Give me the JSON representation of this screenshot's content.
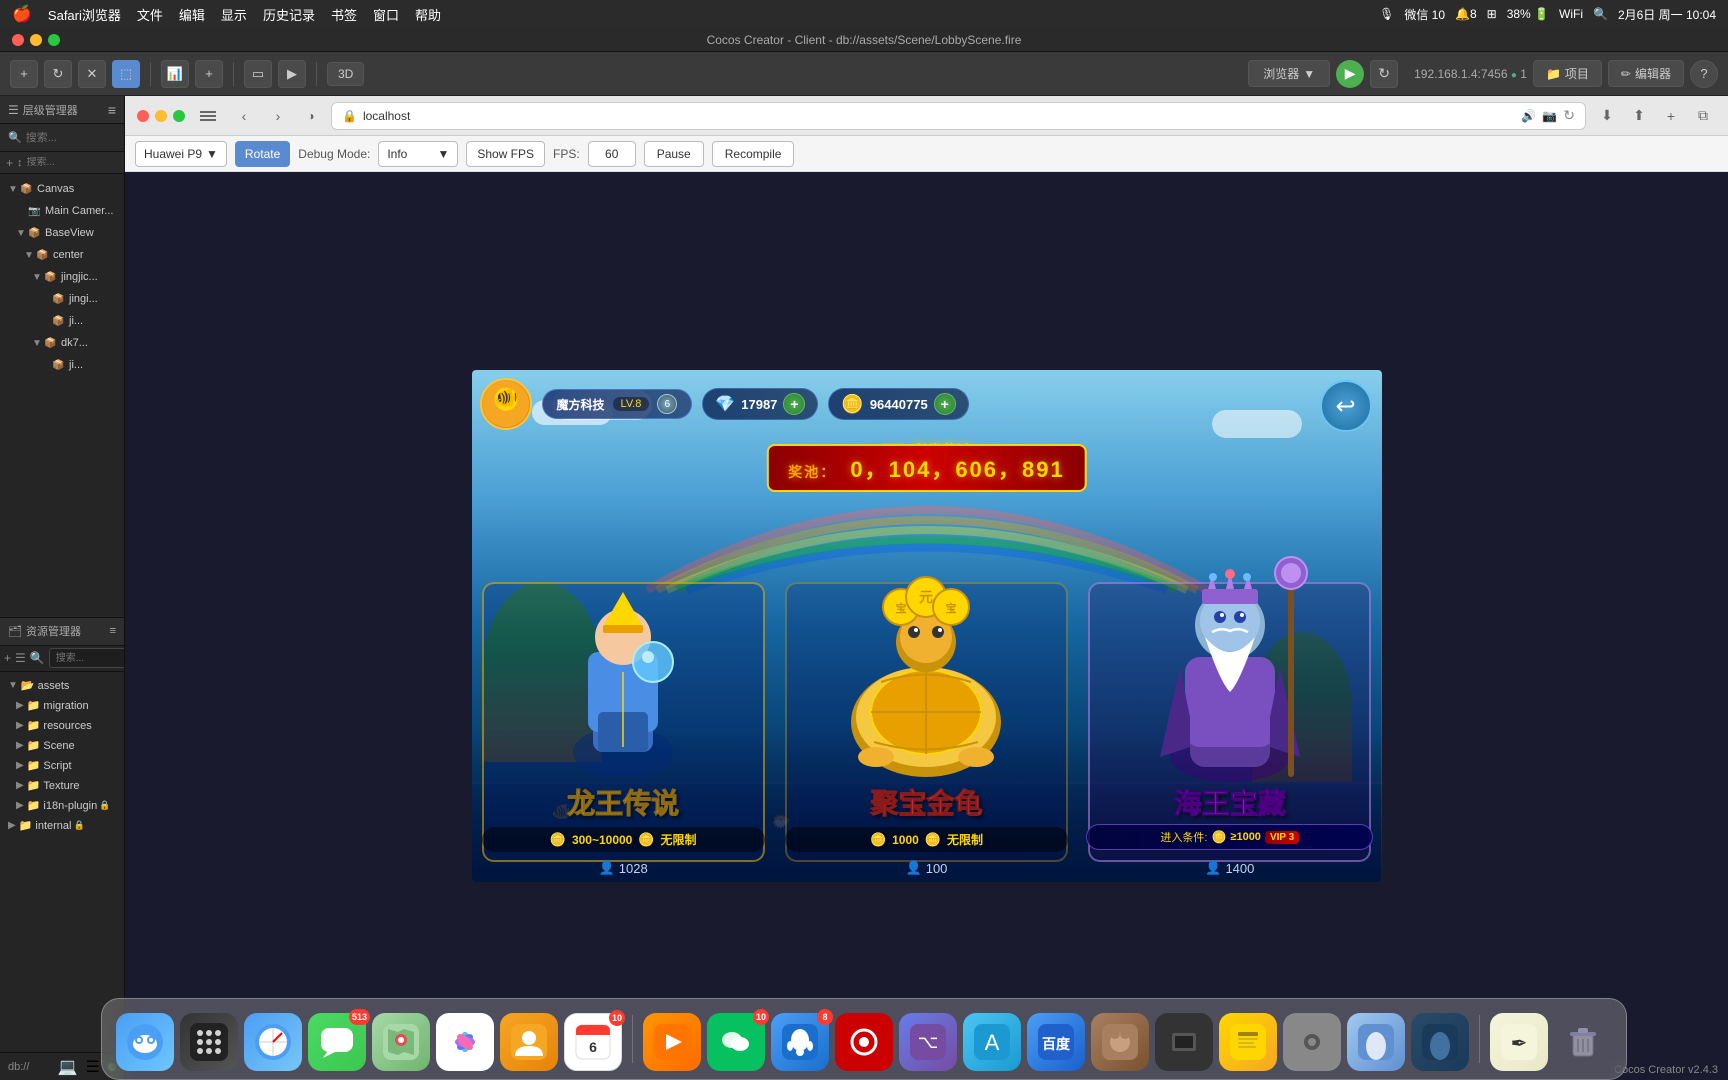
{
  "window": {
    "title": "Cocos Creator - Client - db://assets/Scene/LobbyScene.fire"
  },
  "menubar": {
    "apple": "🍎",
    "app": "Safari浏览器",
    "menus": [
      "文件",
      "编辑",
      "显示",
      "历史记录",
      "书签",
      "窗口",
      "帮助"
    ],
    "right": {
      "siri": "🎙",
      "wechat": "微信",
      "wechat_count": "10",
      "notification": "🔔",
      "notification_count": "8",
      "grid": "⊞",
      "battery": "38%",
      "wifi": "WiFi",
      "search": "🔍",
      "date": "2月6日 周一  10:04"
    }
  },
  "ide_toolbar": {
    "browser_label": "浏览器",
    "ip": "192.168.1.4:7456",
    "device_count": "1",
    "project_label": "项目",
    "editor_label": "编辑器"
  },
  "hierarchy": {
    "header": "层级管理器",
    "search_placeholder": "搜索...",
    "items": [
      {
        "label": "Canvas",
        "level": 0,
        "has_arrow": true,
        "expanded": true
      },
      {
        "label": "Main Camer...",
        "level": 1,
        "has_arrow": false
      },
      {
        "label": "BaseView",
        "level": 1,
        "has_arrow": true,
        "expanded": true
      },
      {
        "label": "center",
        "level": 2,
        "has_arrow": true,
        "expanded": true
      },
      {
        "label": "jingjic...",
        "level": 3,
        "has_arrow": true,
        "expanded": true
      },
      {
        "label": "jingi...",
        "level": 4,
        "has_arrow": false
      },
      {
        "label": "ji...",
        "level": 4,
        "has_arrow": false
      },
      {
        "label": "dk7...",
        "level": 3,
        "has_arrow": true,
        "expanded": true
      },
      {
        "label": "ji...",
        "level": 4,
        "has_arrow": false
      }
    ]
  },
  "assets": {
    "header": "资源管理器",
    "items": [
      {
        "label": "assets",
        "level": 0,
        "type": "folder",
        "expanded": true
      },
      {
        "label": "migration",
        "level": 1,
        "type": "folder"
      },
      {
        "label": "resources",
        "level": 1,
        "type": "folder"
      },
      {
        "label": "Scene",
        "level": 1,
        "type": "folder"
      },
      {
        "label": "Script",
        "level": 1,
        "type": "folder"
      },
      {
        "label": "Texture",
        "level": 1,
        "type": "folder"
      },
      {
        "label": "i18n-plugin",
        "level": 1,
        "type": "folder",
        "locked": true
      },
      {
        "label": "internal",
        "level": 0,
        "type": "folder",
        "locked": true
      }
    ]
  },
  "browser": {
    "url": "localhost"
  },
  "debug_toolbar": {
    "device": "Huawei P9",
    "rotate": "Rotate",
    "debug_mode_label": "Debug Mode:",
    "debug_mode_value": "Info",
    "show_fps": "Show FPS",
    "fps_label": "FPS:",
    "fps_value": "60",
    "pause": "Pause",
    "recompile": "Recompile"
  },
  "game": {
    "player_name": "魔方科技",
    "player_level": "LV.8",
    "diamonds": "17987",
    "coins": "96440775",
    "lottery_title": "彩券奖池",
    "lottery_pool": "奖池：0，104，606，891",
    "cards": [
      {
        "title": "龙王传说",
        "title_class": "dragon-title",
        "min_bet": "300~10000",
        "max_bet": "无限制",
        "coin_icon": "🪙",
        "users": "1028"
      },
      {
        "title": "聚宝金龟",
        "title_class": "treasure-title",
        "min_bet": "1000",
        "max_bet": "无限制",
        "coin_icon": "🪙",
        "users": "100"
      },
      {
        "title": "海王宝藏",
        "title_class": "sea-title",
        "entry_condition": "进入条件:",
        "min_coins": "≥1000",
        "vip": "VIP 3",
        "users": "1400"
      }
    ]
  },
  "version": "Cocos Creator v2.4.3",
  "bottom_status": "db://",
  "dock": [
    {
      "icon": "🔵",
      "label": "finder",
      "badge": null
    },
    {
      "icon": "🎯",
      "label": "launchpad",
      "badge": null
    },
    {
      "icon": "🧭",
      "label": "safari",
      "badge": null
    },
    {
      "icon": "💬",
      "label": "messages",
      "badge": "513"
    },
    {
      "icon": "🗺",
      "label": "maps",
      "badge": null
    },
    {
      "icon": "🌸",
      "label": "photos",
      "badge": null
    },
    {
      "icon": "🟤",
      "label": "contacts",
      "badge": null
    },
    {
      "icon": "📅",
      "label": "calendar",
      "badge": "10"
    },
    {
      "icon": "▶",
      "label": "play",
      "badge": null
    },
    {
      "icon": "💚",
      "label": "wechat",
      "badge": "10"
    },
    {
      "icon": "🐧",
      "label": "qq",
      "badge": "8"
    },
    {
      "icon": "🔴",
      "label": "netease",
      "badge": null
    },
    {
      "icon": "🔧",
      "label": "dev-tools",
      "badge": null
    },
    {
      "icon": "📦",
      "label": "appstore",
      "badge": null
    },
    {
      "icon": "🔵",
      "label": "baidu",
      "badge": null
    },
    {
      "icon": "🐱",
      "label": "bear",
      "badge": null
    },
    {
      "icon": "🖥",
      "label": "parallels",
      "badge": null
    },
    {
      "icon": "📝",
      "label": "notes",
      "badge": null
    },
    {
      "icon": "⚙",
      "label": "system-prefs",
      "badge": null
    },
    {
      "icon": "💧",
      "label": "app1",
      "badge": null
    },
    {
      "icon": "💧",
      "label": "app2",
      "badge": null
    },
    {
      "icon": "✒",
      "label": "writer",
      "badge": null
    },
    {
      "icon": "🗑",
      "label": "trash",
      "badge": null
    }
  ]
}
